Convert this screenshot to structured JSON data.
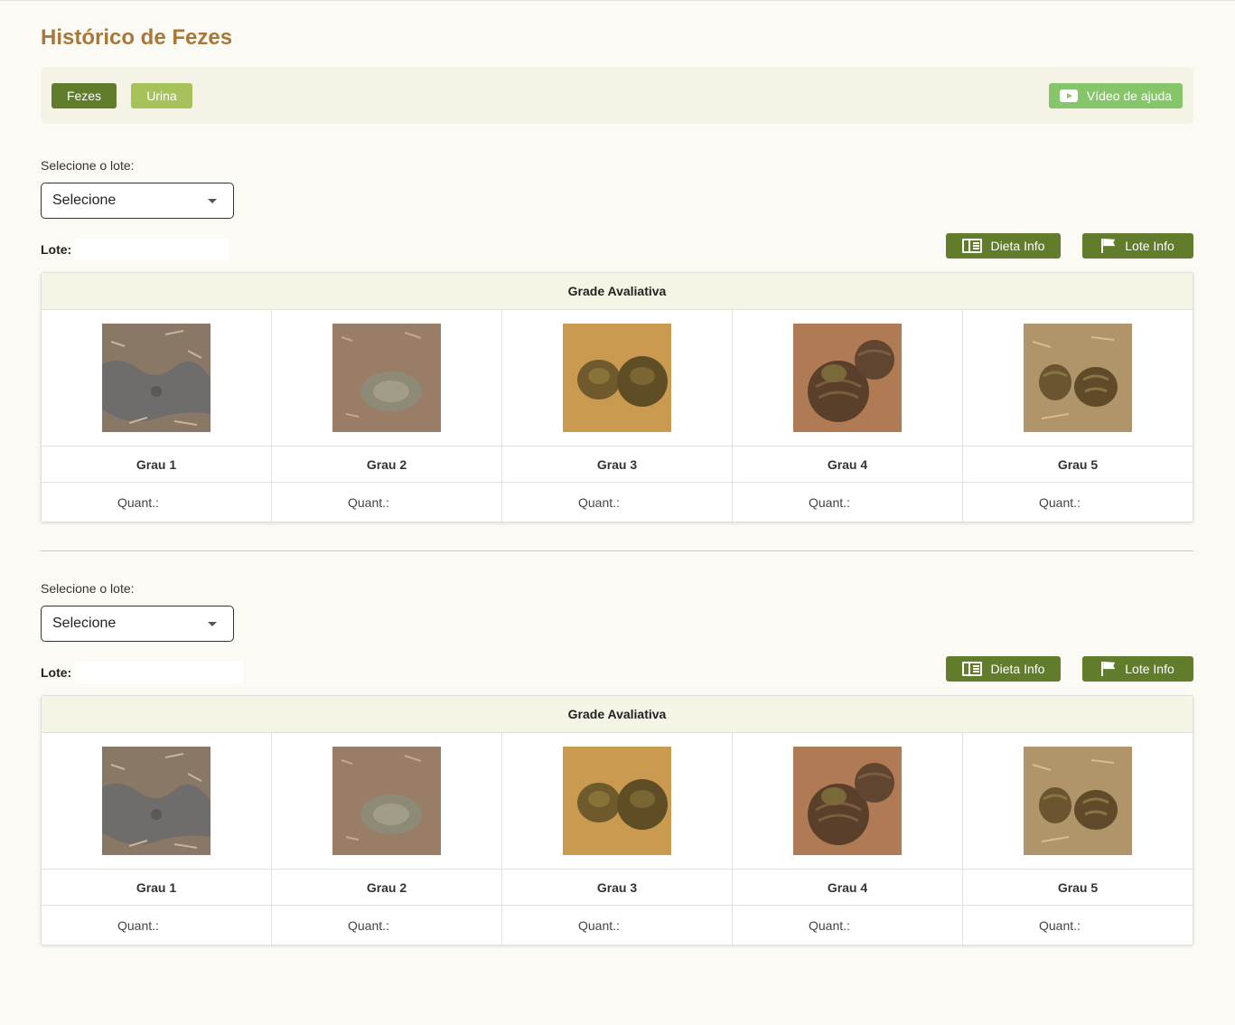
{
  "page_title": "Histórico de Fezes",
  "toolbar": {
    "fezes_label": "Fezes",
    "urina_label": "Urina",
    "video_label": "Vídeo de ajuda"
  },
  "sections": [
    {
      "select_label": "Selecione o lote:",
      "select_value": "Selecione",
      "lote_label": "Lote:",
      "lote_value": "",
      "dieta_label": "Dieta Info",
      "lote_info_label": "Lote Info",
      "grade_title": "Grade Avaliativa",
      "grades": [
        {
          "label": "Grau 1",
          "quant": "Quant.:"
        },
        {
          "label": "Grau 2",
          "quant": "Quant.:"
        },
        {
          "label": "Grau 3",
          "quant": "Quant.:"
        },
        {
          "label": "Grau 4",
          "quant": "Quant.:"
        },
        {
          "label": "Grau 5",
          "quant": "Quant.:"
        }
      ]
    },
    {
      "select_label": "Selecione o lote:",
      "select_value": "Selecione",
      "lote_label": "Lote:",
      "lote_value": "",
      "dieta_label": "Dieta Info",
      "lote_info_label": "Lote Info",
      "grade_title": "Grade Avaliativa",
      "grades": [
        {
          "label": "Grau 1",
          "quant": "Quant.:"
        },
        {
          "label": "Grau 2",
          "quant": "Quant.:"
        },
        {
          "label": "Grau 3",
          "quant": "Quant.:"
        },
        {
          "label": "Grau 4",
          "quant": "Quant.:"
        },
        {
          "label": "Grau 5",
          "quant": "Quant.:"
        }
      ]
    }
  ],
  "colors": {
    "title": "#a8773a",
    "primary_button": "#617d2b",
    "secondary_button": "#a7c15b",
    "help_button": "#86c56a",
    "grade_header_bg": "#f4f5e4"
  },
  "icons": {
    "video": "youtube-play-icon",
    "dieta": "book-icon",
    "lote": "flag-icon"
  }
}
